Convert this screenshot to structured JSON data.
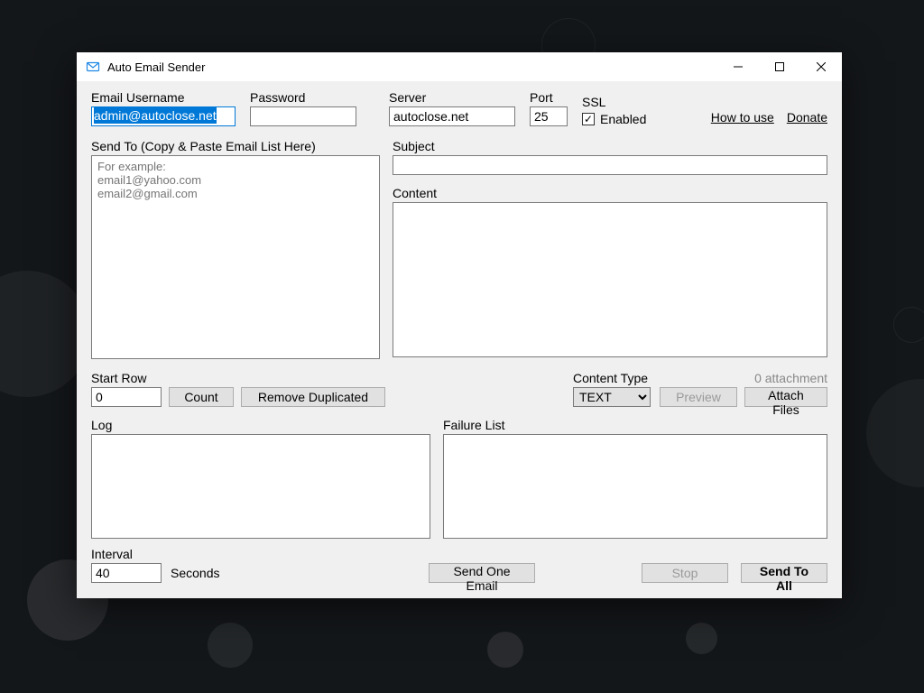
{
  "window": {
    "title": "Auto Email Sender"
  },
  "credentials": {
    "username_label": "Email Username",
    "username_value": "admin@autoclose.net",
    "password_label": "Password",
    "password_value": "",
    "server_label": "Server",
    "server_value": "autoclose.net",
    "port_label": "Port",
    "port_value": "25",
    "ssl_label": "SSL",
    "ssl_checkbox_label": "Enabled",
    "ssl_checked": true
  },
  "links": {
    "how_to_use": "How to use",
    "donate": "Donate"
  },
  "send_to": {
    "label": "Send To (Copy & Paste Email List Here)",
    "placeholder": "For example:\nemail1@yahoo.com\nemail2@gmail.com",
    "value": ""
  },
  "subject": {
    "label": "Subject",
    "value": ""
  },
  "content": {
    "label": "Content",
    "value": ""
  },
  "start_row": {
    "label": "Start Row",
    "value": "0"
  },
  "buttons": {
    "count": "Count",
    "remove_dup": "Remove Duplicated",
    "preview": "Preview",
    "attach_files": "Attach Files",
    "send_one": "Send One Email",
    "stop": "Stop",
    "send_all": "Send To All"
  },
  "content_type": {
    "label": "Content Type",
    "selected": "TEXT"
  },
  "attachment": {
    "count_text": "0 attachment"
  },
  "log": {
    "label": "Log",
    "value": ""
  },
  "failure": {
    "label": "Failure List",
    "value": ""
  },
  "interval": {
    "label": "Interval",
    "value": "40",
    "unit": "Seconds"
  }
}
